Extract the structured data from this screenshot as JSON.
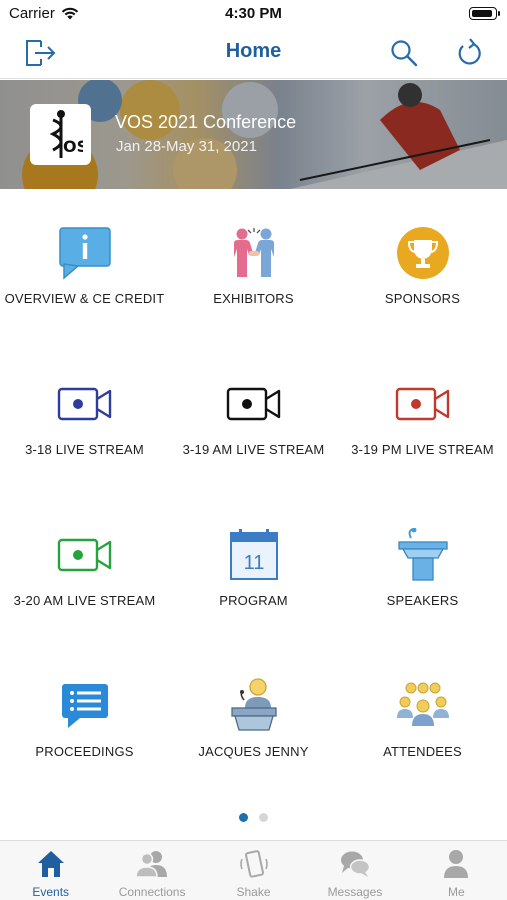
{
  "status_bar": {
    "carrier": "Carrier",
    "time": "4:30 PM"
  },
  "nav": {
    "title": "Home",
    "left_icon": "logout-icon",
    "right_icons": [
      "search-icon",
      "refresh-icon"
    ]
  },
  "banner": {
    "title": "VOS 2021 Conference",
    "dates": "Jan 28-May 31, 2021",
    "logo_icon": "vos-logo-icon"
  },
  "grid": {
    "tiles": [
      {
        "label": "OVERVIEW & CE CREDIT",
        "icon": "info-bubble-icon",
        "color": "#5aaee6"
      },
      {
        "label": "EXHIBITORS",
        "icon": "handshake-icon",
        "color": "#e06a8a"
      },
      {
        "label": "SPONSORS",
        "icon": "trophy-icon",
        "color": "#e8a820"
      },
      {
        "label": "3-18 LIVE STREAM",
        "icon": "video-camera-icon",
        "color": "#2e3d9c"
      },
      {
        "label": "3-19 AM LIVE STREAM",
        "icon": "video-camera-icon",
        "color": "#111111"
      },
      {
        "label": "3-19 PM LIVE STREAM",
        "icon": "video-camera-icon",
        "color": "#c0392b"
      },
      {
        "label": "3-20 AM LIVE STREAM",
        "icon": "video-camera-icon",
        "color": "#27a33b"
      },
      {
        "label": "PROGRAM",
        "icon": "calendar-icon",
        "color": "#3c7cc4",
        "day": "11"
      },
      {
        "label": "SPEAKERS",
        "icon": "podium-icon",
        "color": "#4a9ad8"
      },
      {
        "label": "PROCEEDINGS",
        "icon": "list-bubble-icon",
        "color": "#2a8ad8"
      },
      {
        "label": "JACQUES JENNY",
        "icon": "speaker-at-podium-icon",
        "color": "#4a7aa8"
      },
      {
        "label": "ATTENDEES",
        "icon": "group-icon",
        "color": "#e8c048"
      }
    ]
  },
  "pager": {
    "pages": 2,
    "active_page": 1
  },
  "tab_bar": {
    "tabs": [
      {
        "label": "Events",
        "icon": "home-icon",
        "active": true
      },
      {
        "label": "Connections",
        "icon": "people-icon",
        "active": false
      },
      {
        "label": "Shake",
        "icon": "shake-phone-icon",
        "active": false
      },
      {
        "label": "Messages",
        "icon": "chat-bubbles-icon",
        "active": false
      },
      {
        "label": "Me",
        "icon": "person-icon",
        "active": false
      }
    ]
  },
  "colors": {
    "accent": "#1f5f9f",
    "inactive": "#9a9a9a",
    "pager_active": "#1f6fae"
  }
}
